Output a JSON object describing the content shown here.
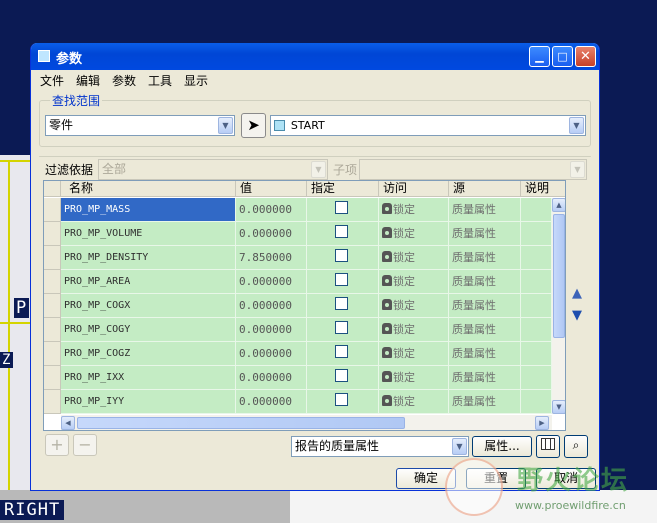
{
  "window": {
    "title": "参数"
  },
  "menu": [
    "文件",
    "编辑",
    "参数",
    "工具",
    "显示"
  ],
  "search": {
    "group_label": "查找范围",
    "scope": "零件",
    "model": "START"
  },
  "filter": {
    "label": "过滤依据",
    "value": "全部",
    "sub_label": "子项",
    "sub_value": ""
  },
  "table": {
    "headers": [
      "名称",
      "值",
      "指定",
      "访问",
      "源",
      "说明"
    ],
    "rows": [
      {
        "name": "PRO_MP_MASS",
        "value": "0.000000",
        "access": "锁定",
        "source": "质量属性"
      },
      {
        "name": "PRO_MP_VOLUME",
        "value": "0.000000",
        "access": "锁定",
        "source": "质量属性"
      },
      {
        "name": "PRO_MP_DENSITY",
        "value": "7.850000",
        "access": "锁定",
        "source": "质量属性"
      },
      {
        "name": "PRO_MP_AREA",
        "value": "0.000000",
        "access": "锁定",
        "source": "质量属性"
      },
      {
        "name": "PRO_MP_COGX",
        "value": "0.000000",
        "access": "锁定",
        "source": "质量属性"
      },
      {
        "name": "PRO_MP_COGY",
        "value": "0.000000",
        "access": "锁定",
        "source": "质量属性"
      },
      {
        "name": "PRO_MP_COGZ",
        "value": "0.000000",
        "access": "锁定",
        "source": "质量属性"
      },
      {
        "name": "PRO_MP_IXX",
        "value": "0.000000",
        "access": "锁定",
        "source": "质量属性"
      },
      {
        "name": "PRO_MP_IYY",
        "value": "0.000000",
        "access": "锁定",
        "source": "质量属性"
      }
    ],
    "selected_row": 0
  },
  "bottom": {
    "add": "+",
    "remove": "−",
    "report_select": "报告的质量属性",
    "properties_button": "属性..."
  },
  "footer": {
    "ok": "确定",
    "reset": "重置",
    "cancel": "取消"
  },
  "background": {
    "labels": [
      "P",
      "Z",
      "RIGHT"
    ]
  },
  "watermark": {
    "text": "野火论坛",
    "url": "www.proewildfire.cn"
  },
  "colors": {
    "title_bar": "#0046d5",
    "row_fill": "#c4ecc4",
    "selection": "#3169c6",
    "group_label": "#0033cc"
  }
}
